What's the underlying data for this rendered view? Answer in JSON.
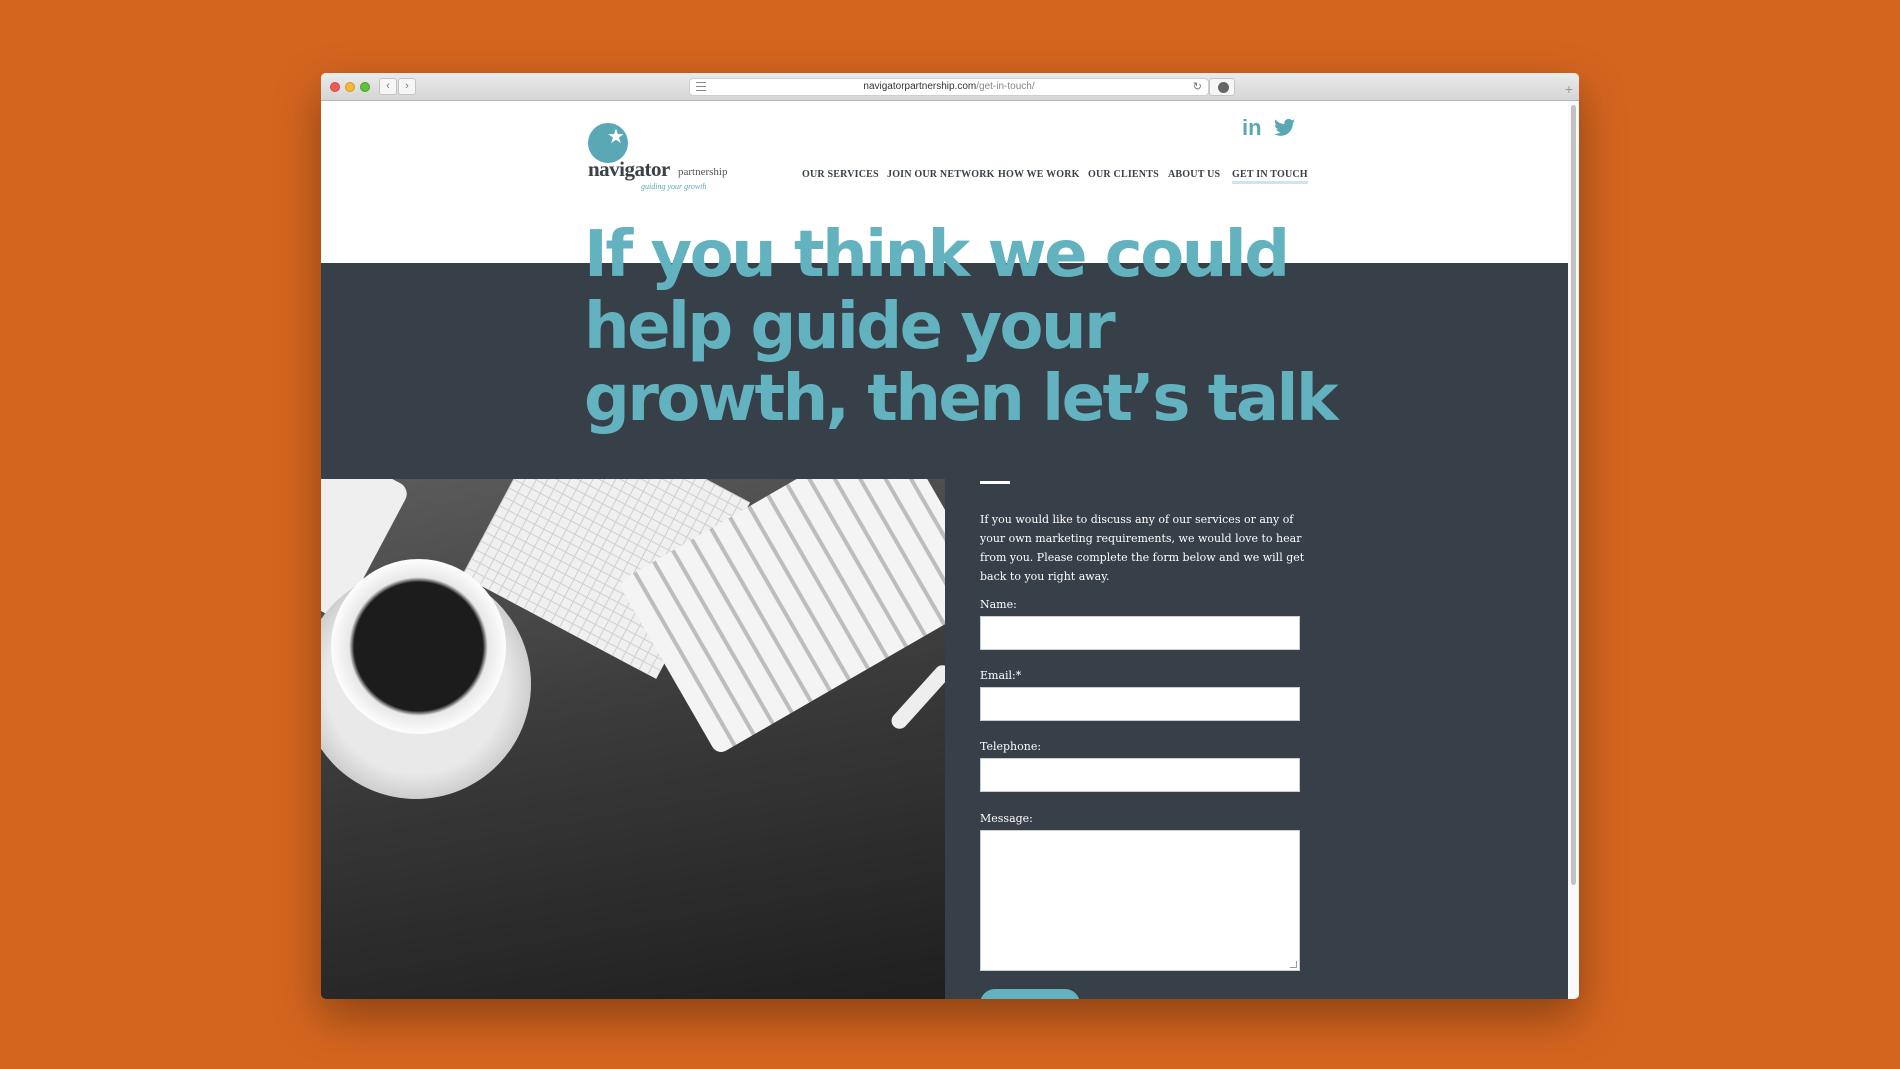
{
  "browser": {
    "url_domain": "navigatorpartnership.com",
    "url_path": "/get-in-touch/",
    "back_glyph": "‹",
    "forward_glyph": "›",
    "reload_glyph": "↻",
    "plus_glyph": "+"
  },
  "site": {
    "logo_word": "navigator",
    "logo_sub": "partnership",
    "logo_tag": "guiding your growth",
    "brand_color": "#63b2bf",
    "dark_bg": "#373f48"
  },
  "social": {
    "linkedin_label": "in",
    "twitter_icon": "twitter-bird-icon"
  },
  "nav": {
    "items": [
      {
        "label": "OUR SERVICES"
      },
      {
        "label": "JOIN OUR NETWORK"
      },
      {
        "label": "HOW WE WORK"
      },
      {
        "label": "OUR CLIENTS"
      },
      {
        "label": "ABOUT US"
      },
      {
        "label": "GET IN TOUCH"
      }
    ]
  },
  "hero": {
    "line1": "If you think we could",
    "line2": "help guide your",
    "line3": "growth, then let’s talk"
  },
  "form": {
    "intro": "If you would like to discuss any of our services or any of your own marketing requirements, we would love to hear from you. Please complete the form below and we will get back to you right away.",
    "name_label": "Name:",
    "email_label": "Email:*",
    "telephone_label": "Telephone:",
    "message_label": "Message:",
    "name_value": "",
    "email_value": "",
    "telephone_value": "",
    "message_value": ""
  }
}
